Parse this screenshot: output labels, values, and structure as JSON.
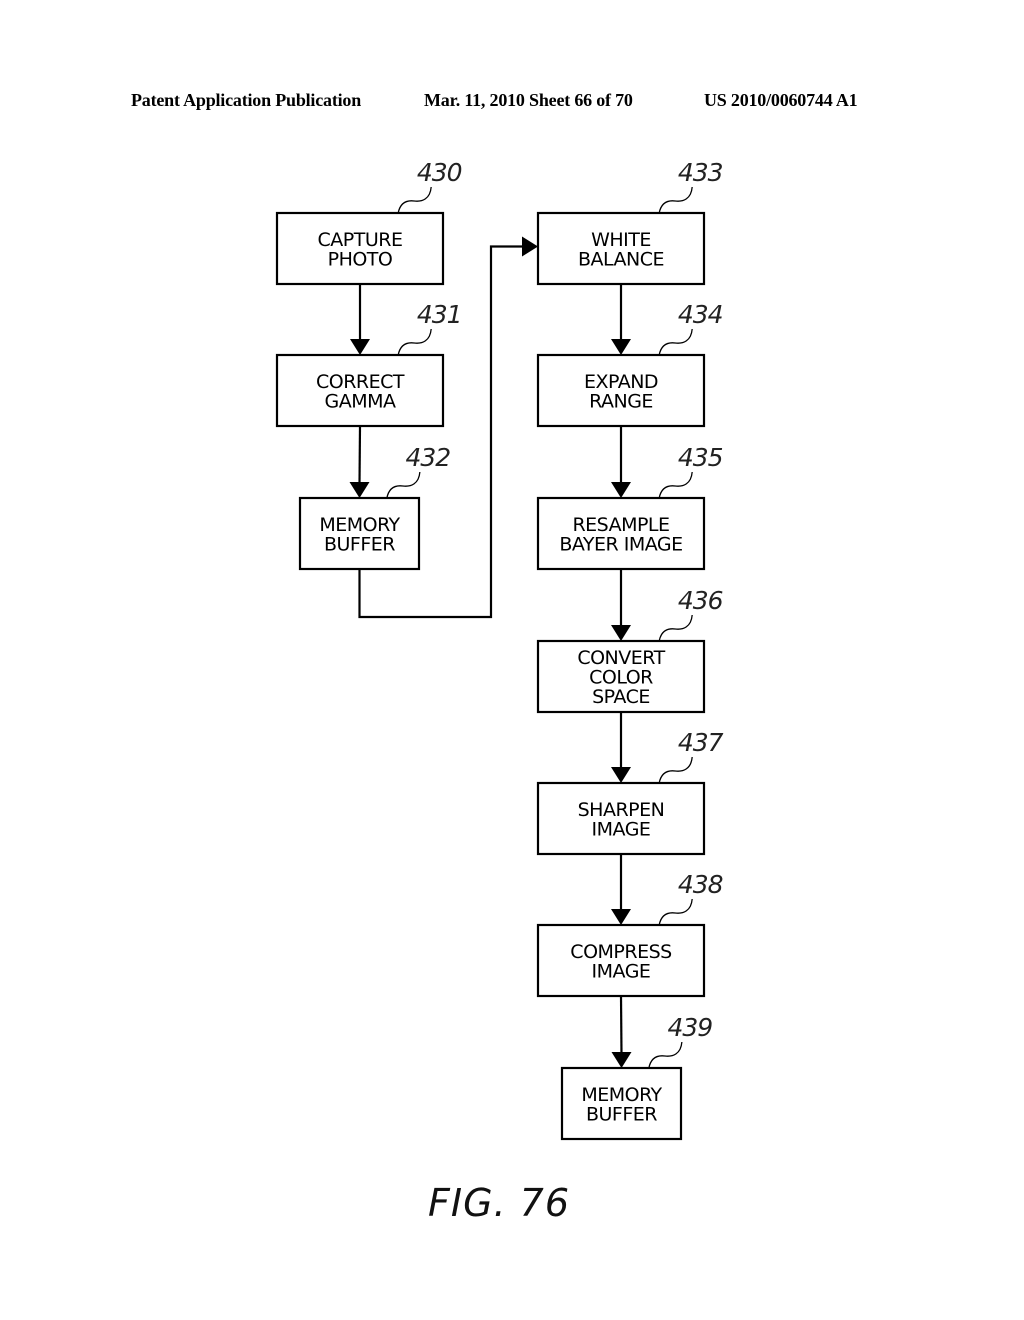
{
  "header": {
    "left": "Patent Application Publication",
    "center": "Mar. 11, 2010  Sheet 66 of 70",
    "right": "US 2010/0060744 A1"
  },
  "figure_label": "FIG. 76",
  "nodes": [
    {
      "id": "430",
      "ref": "430",
      "lines": [
        "CAPTURE",
        "PHOTO"
      ]
    },
    {
      "id": "431",
      "ref": "431",
      "lines": [
        "CORRECT",
        "GAMMA"
      ]
    },
    {
      "id": "432",
      "ref": "432",
      "lines": [
        "MEMORY",
        "BUFFER"
      ]
    },
    {
      "id": "433",
      "ref": "433",
      "lines": [
        "WHITE",
        "BALANCE"
      ]
    },
    {
      "id": "434",
      "ref": "434",
      "lines": [
        "EXPAND",
        "RANGE"
      ]
    },
    {
      "id": "435",
      "ref": "435",
      "lines": [
        "RESAMPLE",
        "BAYER IMAGE"
      ]
    },
    {
      "id": "436",
      "ref": "436",
      "lines": [
        "CONVERT",
        "COLOR",
        "SPACE"
      ]
    },
    {
      "id": "437",
      "ref": "437",
      "lines": [
        "SHARPEN",
        "IMAGE"
      ]
    },
    {
      "id": "438",
      "ref": "438",
      "lines": [
        "COMPRESS",
        "IMAGE"
      ]
    },
    {
      "id": "439",
      "ref": "439",
      "lines": [
        "MEMORY",
        "BUFFER"
      ]
    }
  ],
  "edges": [
    {
      "from": "430",
      "to": "431"
    },
    {
      "from": "431",
      "to": "432"
    },
    {
      "from": "432",
      "to": "433"
    },
    {
      "from": "433",
      "to": "434"
    },
    {
      "from": "434",
      "to": "435"
    },
    {
      "from": "435",
      "to": "436"
    },
    {
      "from": "436",
      "to": "437"
    },
    {
      "from": "437",
      "to": "438"
    },
    {
      "from": "438",
      "to": "439"
    }
  ]
}
